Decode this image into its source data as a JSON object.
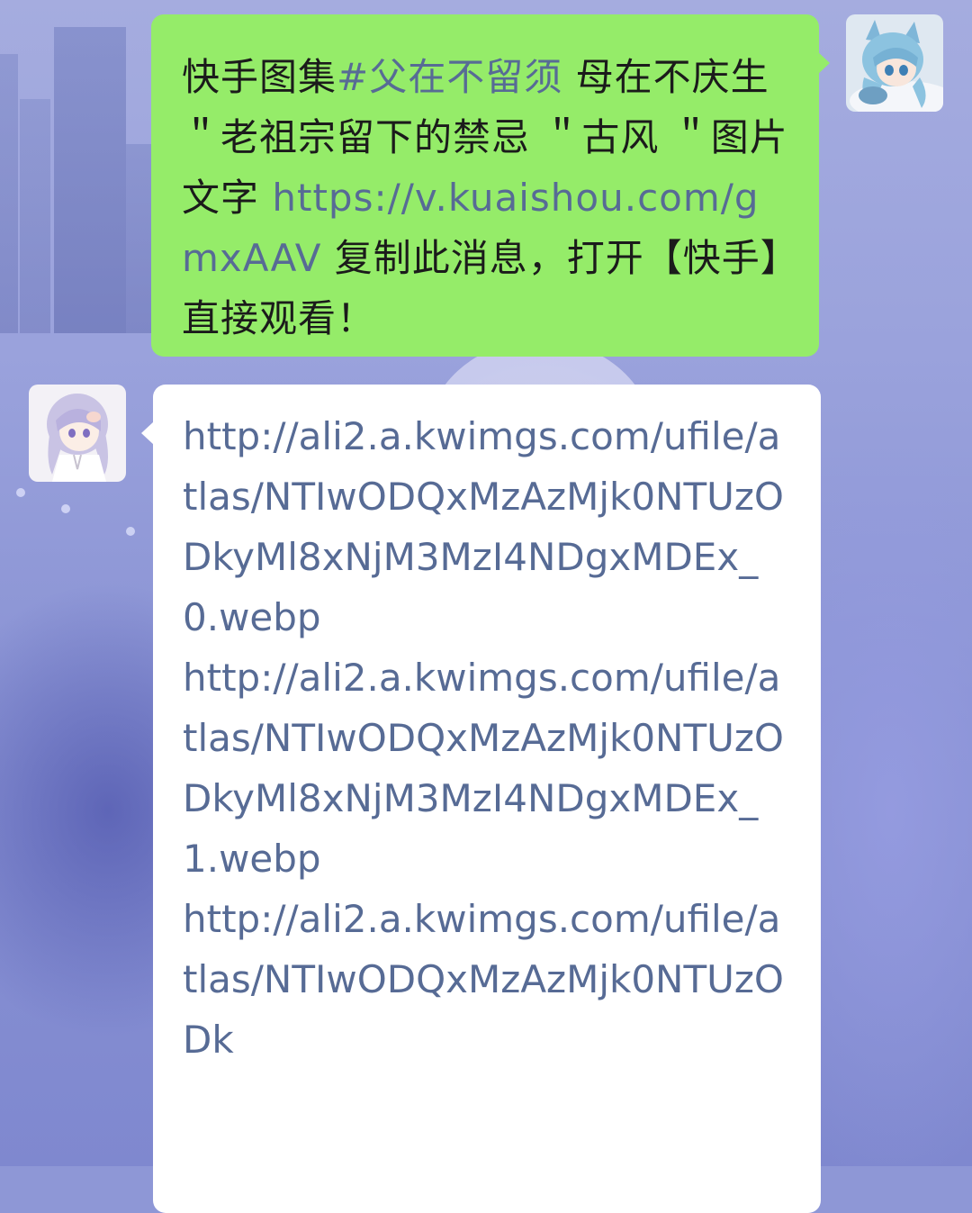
{
  "conversation": {
    "outgoing": {
      "text_prefix": "快手图集",
      "topic": "#父在不留须",
      "text_middle": " 母在不庆生 ＂老祖宗留下的禁忌 ＂古风 ＂图片文字 ",
      "link": "https://v.kuaishou.com/gmxAAV",
      "text_suffix": " 复制此消息，打开【快手】直接观看！"
    },
    "incoming": {
      "lines": [
        "http://ali2.a.kwimgs.com/ufile/atlas/NTIwODQxMzAzMjk0NTUzODkyMl8xNjM3MzI4NDgxMDEx_0.webp",
        "http://ali2.a.kwimgs.com/ufile/atlas/NTIwODQxMzAzMjk0NTUzODkyMl8xNjM3MzI4NDgxMDEx_1.webp",
        "http://ali2.a.kwimgs.com/ufile/atlas/NTIwODQxMzAzMjk0NTUzODk"
      ]
    }
  },
  "colors": {
    "outgoing_bubble": "#95ec69",
    "incoming_bubble": "#ffffff",
    "link": "#576b95",
    "text": "#1b1b1b"
  },
  "icons": {
    "outgoing_avatar": "anime-girl-blue-hair-avatar",
    "incoming_avatar": "anime-girl-lavender-hair-avatar"
  }
}
